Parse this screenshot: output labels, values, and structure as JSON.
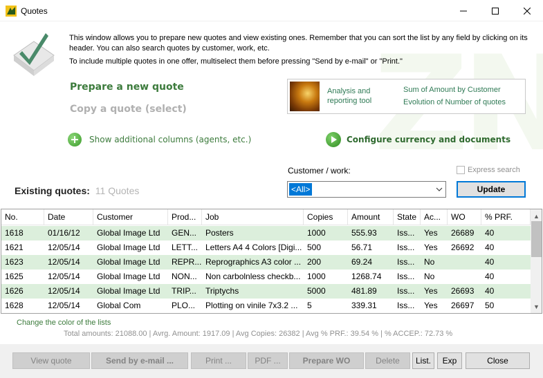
{
  "window": {
    "title": "Quotes"
  },
  "intro": {
    "line1": "This window allows you to prepare new quotes and view existing ones. Remember that you can sort the list by any field by clicking on its header. You can also search quotes by customer, work, etc.",
    "line2": "To include multiple quotes in one offer, multiselect them before pressing \"Send by e-mail\" or \"Print.\""
  },
  "watermark": "ZN",
  "actions": {
    "prepare": "Prepare a new quote",
    "copy": "Copy a quote (select)",
    "show_columns": "Show additional columns (agents, etc.)",
    "configure": "Configure currency and documents"
  },
  "analysis": {
    "title": "Analysis and reporting tool",
    "link1": "Sum of Amount by Customer",
    "link2": "Evolution of Number of quotes"
  },
  "filter": {
    "customer_label": "Customer / work:",
    "customer_value": "<All>",
    "express_label": "Express search",
    "update_label": "Update"
  },
  "existing": {
    "label": "Existing quotes:",
    "count": "11 Quotes"
  },
  "table": {
    "headers": [
      "No.",
      "Date",
      "Customer",
      "Prod...",
      "Job",
      "Copies",
      "Amount",
      "State",
      "Ac...",
      "WO",
      "% PRF."
    ],
    "rows": [
      [
        "1618",
        "01/16/12",
        "Global Image Ltd",
        "GEN...",
        "Posters",
        "1000",
        "555.93",
        "Iss...",
        "Yes",
        "26689",
        "40"
      ],
      [
        "1621",
        "12/05/14",
        "Global Image Ltd",
        "LETT...",
        "Letters A4 4 Colors [Digi...",
        "500",
        "56.71",
        "Iss...",
        "Yes",
        "26692",
        "40"
      ],
      [
        "1623",
        "12/05/14",
        "Global Image Ltd",
        "REPR...",
        "Reprographics A3 color ...",
        "200",
        "69.24",
        "Iss...",
        "No",
        "",
        "40"
      ],
      [
        "1625",
        "12/05/14",
        "Global Image Ltd",
        "NON...",
        "Non carbolnless checkb...",
        "1000",
        "1268.74",
        "Iss...",
        "No",
        "",
        "40"
      ],
      [
        "1626",
        "12/05/14",
        "Global Image Ltd",
        "TRIP...",
        "Triptychs",
        "5000",
        "481.89",
        "Iss...",
        "Yes",
        "26693",
        "40"
      ],
      [
        "1628",
        "12/05/14",
        "Global Com",
        "PLO...",
        "Plotting on vinile 7x3.2 ...",
        "5",
        "339.31",
        "Iss...",
        "Yes",
        "26697",
        "50"
      ]
    ]
  },
  "summary": {
    "change_color": "Change the color of the lists",
    "totals": "Total amounts: 21088.00  |  Avrg. Amount: 1917.09  |  Avg Copies: 26382  |  Avg % PRF.: 39.54 %  |  % ACCEP.: 72.73 %"
  },
  "footer": {
    "view_quote": "View quote",
    "send_email": "Send by e-mail ...",
    "print": "Print ...",
    "pdf": "PDF ...",
    "prepare_wo": "Prepare WO",
    "delete": "Delete",
    "list": "List.",
    "exp": "Exp",
    "close": "Close"
  },
  "colors": {
    "accent_green": "#3c7b3c",
    "row_highlight": "#dcefdc",
    "selection_blue": "#0078d7"
  }
}
